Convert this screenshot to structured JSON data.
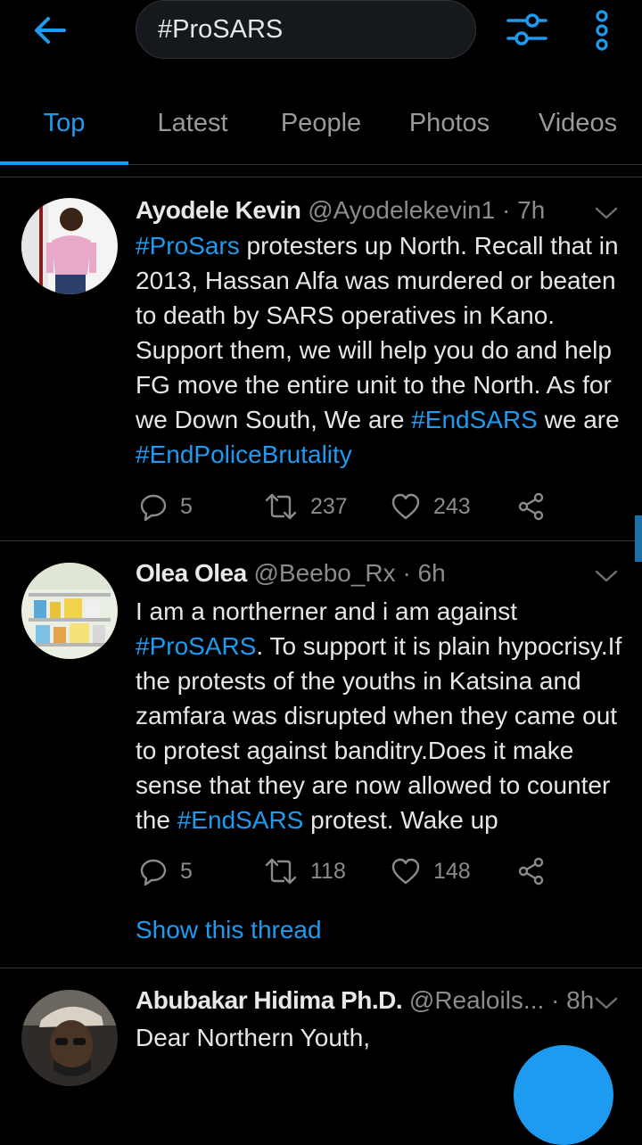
{
  "search": {
    "query": "#ProSARS"
  },
  "tabs": [
    {
      "label": "Top"
    },
    {
      "label": "Latest"
    },
    {
      "label": "People"
    },
    {
      "label": "Photos"
    },
    {
      "label": "Videos"
    }
  ],
  "active_tab": "Top",
  "colors": {
    "accent": "#1d9bf0",
    "background": "#000000",
    "secondary_text": "#8b8b8b"
  },
  "tweets": [
    {
      "name": "Ayodele Kevin",
      "handle": "@Ayodelekevin1",
      "separator": "·",
      "time": "7h",
      "text": [
        {
          "type": "tag",
          "value": "#ProSars"
        },
        {
          "type": "text",
          "value": " protesters up North. Recall that in 2013, Hassan Alfa was  murdered or beaten to death by SARS operatives in Kano. Support them, we will help you do and help FG move the entire unit to the North. As for we Down South, We are "
        },
        {
          "type": "tag",
          "value": "#EndSARS"
        },
        {
          "type": "text",
          "value": " we are "
        },
        {
          "type": "tag",
          "value": "#EndPoliceBrutality"
        }
      ],
      "replies": "5",
      "retweets": "237",
      "likes": "243"
    },
    {
      "name": "Olea Olea",
      "handle": "@Beebo_Rx",
      "separator": "·",
      "time": "6h",
      "text": [
        {
          "type": "text",
          "value": "I am a northerner and i am against "
        },
        {
          "type": "tag",
          "value": "#ProSARS"
        },
        {
          "type": "text",
          "value": ". To support it is plain hypocrisy.If the protests of the  youths in Katsina and zamfara  was disrupted  when they came out to protest against banditry.Does it make sense that they are now allowed to counter the "
        },
        {
          "type": "tag",
          "value": "#EndSARS"
        },
        {
          "type": "text",
          "value": " protest. Wake up"
        }
      ],
      "replies": "5",
      "retweets": "118",
      "likes": "148",
      "show_thread": "Show this thread"
    },
    {
      "name": "Abubakar Hidima Ph.D.",
      "handle": "@Realoils...",
      "separator": "·",
      "time": "8h",
      "text": [
        {
          "type": "text",
          "value": "Dear Northern Youth,"
        }
      ]
    }
  ]
}
